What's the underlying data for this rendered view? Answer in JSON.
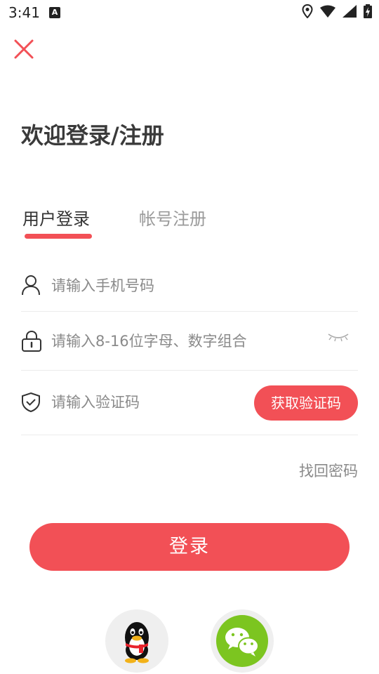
{
  "status_bar": {
    "time": "3:41",
    "notification_badge": "A"
  },
  "welcome_title": "欢迎登录/注册",
  "tabs": {
    "login": "用户登录",
    "register": "帐号注册",
    "active": "login"
  },
  "fields": {
    "phone_placeholder": "请输入手机号码",
    "password_placeholder": "请输入8-16位字母、数字组合",
    "code_placeholder": "请输入验证码"
  },
  "get_code_label": "获取验证码",
  "forgot_password": "找回密码",
  "login_button": "登录",
  "colors": {
    "accent": "#f25056",
    "wechat": "#7cc520"
  },
  "icons": [
    "close-icon",
    "user-icon",
    "lock-icon",
    "eye-closed-icon",
    "shield-check-icon",
    "qq-icon",
    "wechat-icon"
  ]
}
